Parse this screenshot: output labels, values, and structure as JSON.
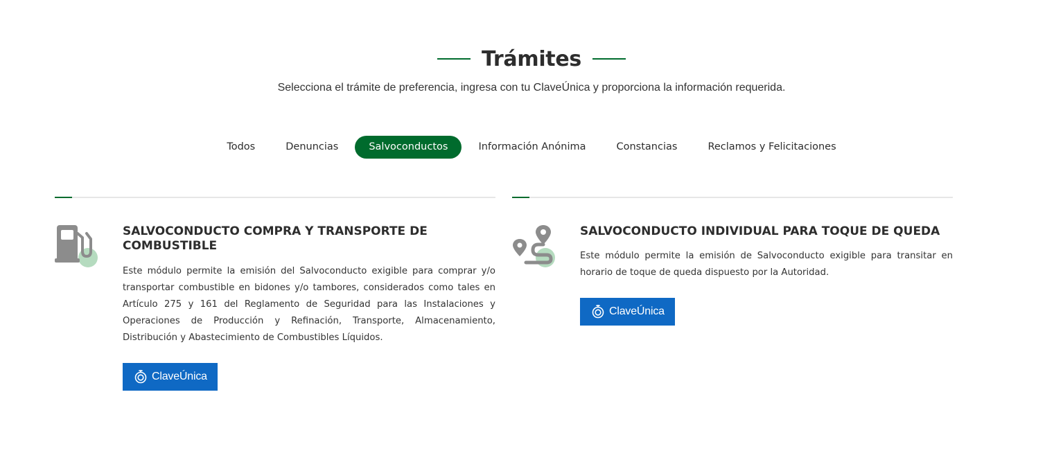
{
  "header": {
    "title": "Trámites",
    "subtitle": "Selecciona el trámite de preferencia, ingresa con tu ClaveÚnica y proporciona la información requerida."
  },
  "tabs": [
    {
      "label": "Todos",
      "active": false
    },
    {
      "label": "Denuncias",
      "active": false
    },
    {
      "label": "Salvoconductos",
      "active": true
    },
    {
      "label": "Información Anónima",
      "active": false
    },
    {
      "label": "Constancias",
      "active": false
    },
    {
      "label": "Reclamos y Felicitaciones",
      "active": false
    }
  ],
  "cards": [
    {
      "icon": "fuel-pump-icon",
      "title": "SALVOCONDUCTO COMPRA Y TRANSPORTE DE COMBUSTIBLE",
      "description": "Este módulo permite la emisión del Salvoconducto exigible para comprar y/o transportar combustible en bidones y/o tambores, considerados como tales en Artículo 275 y 161 del Reglamento de Seguridad para las Instalaciones y Operaciones de Producción y Refinación, Transporte, Almacenamiento, Distribución y Abastecimiento de Combustibles Líquidos.",
      "button_label": "ClaveÚnica"
    },
    {
      "icon": "route-icon",
      "title": "SALVOCONDUCTO INDIVIDUAL PARA TOQUE DE QUEDA",
      "description": "Este módulo permite la emisión de Salvoconducto exigible para transitar en horario de toque de queda dispuesto por la Autoridad.",
      "button_label": "ClaveÚnica"
    }
  ],
  "colors": {
    "brand_green": "#006b2d",
    "claveunica_blue": "#0f69c4",
    "icon_gray": "#8c8c8c",
    "icon_accent": "#a8d5b4"
  }
}
